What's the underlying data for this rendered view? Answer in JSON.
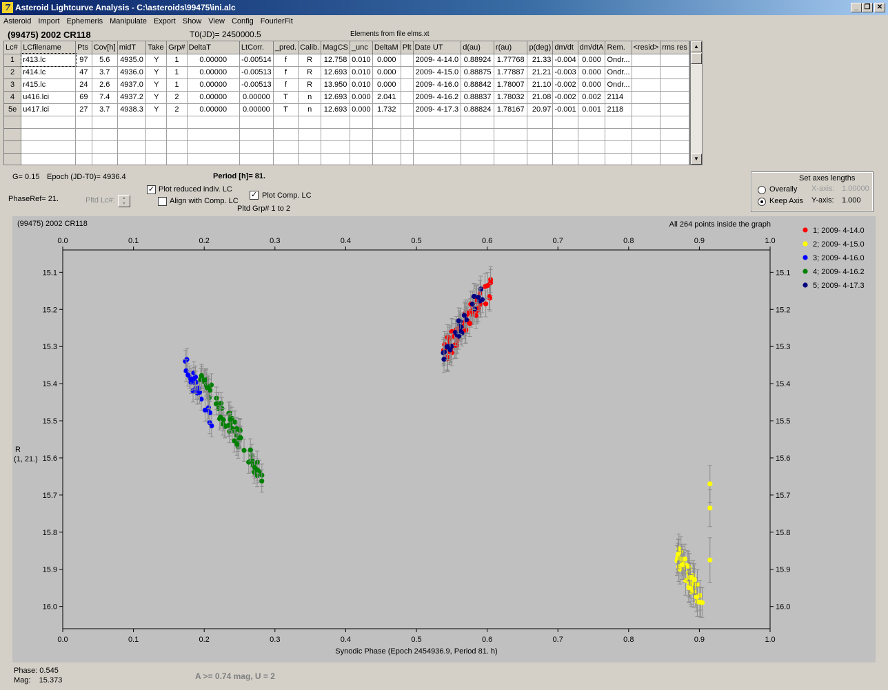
{
  "window": {
    "title": "Asteroid Lightcurve Analysis - C:\\asteroids\\99475\\ini.alc",
    "minimize": "_",
    "restore": "❐",
    "close": "✕"
  },
  "menu": [
    "Asteroid",
    "Import",
    "Ephemeris",
    "Manipulate",
    "Export",
    "Show",
    "View",
    "Config",
    "FourierFit"
  ],
  "header": {
    "asteroid": "(99475) 2002 CR118",
    "t0": "T0(JD)= 2450000.5",
    "elements": "Elements from file elms.xt"
  },
  "grid": {
    "columns": [
      "Lc#",
      "LCfilename",
      "Pts",
      "Cov[h]",
      "midT",
      "Take",
      "Grp#",
      "DeltaT",
      "LtCorr.",
      "_pred.",
      "Calib.",
      "MagCS",
      "_unc",
      "DeltaM",
      "Plt",
      "Date UT",
      "d(au)",
      "r(au)",
      "p(deg)",
      "dm/dt",
      "dm/dtA",
      "Rem.",
      "<resid>",
      "rms res"
    ],
    "rows": [
      [
        "1",
        "r413.lc",
        "97",
        "5.6",
        "4935.0",
        "Y",
        "1",
        "0.00000",
        "-0.00514",
        "f",
        "R",
        "12.758",
        "0.010",
        "0.000",
        "",
        "2009- 4-14.0",
        "0.88924",
        "1.77768",
        "21.33",
        "-0.004",
        "0.000",
        "Ondr...",
        "",
        ""
      ],
      [
        "2",
        "r414.lc",
        "47",
        "3.7",
        "4936.0",
        "Y",
        "1",
        "0.00000",
        "-0.00513",
        "f",
        "R",
        "12.693",
        "0.010",
        "0.000",
        "",
        "2009- 4-15.0",
        "0.88875",
        "1.77887",
        "21.21",
        "-0.003",
        "0.000",
        "Ondr...",
        "",
        ""
      ],
      [
        "3",
        "r415.lc",
        "24",
        "2.6",
        "4937.0",
        "Y",
        "1",
        "0.00000",
        "-0.00513",
        "f",
        "R",
        "13.950",
        "0.010",
        "0.000",
        "",
        "2009- 4-16.0",
        "0.88842",
        "1.78007",
        "21.10",
        "-0.002",
        "0.000",
        "Ondr...",
        "",
        ""
      ],
      [
        "4",
        "u416.lci",
        "69",
        "7.4",
        "4937.2",
        "Y",
        "2",
        "0.00000",
        "0.00000",
        "T",
        "n",
        "12.693",
        "0.000",
        "2.041",
        "",
        "2009- 4-16.2",
        "0.88837",
        "1.78032",
        "21.08",
        "-0.002",
        "0.002",
        "2114",
        "",
        ""
      ],
      [
        "5e",
        "u417.lci",
        "27",
        "3.7",
        "4938.3",
        "Y",
        "2",
        "0.00000",
        "0.00000",
        "T",
        "n",
        "12.693",
        "0.000",
        "1.732",
        "",
        "2009- 4-17.3",
        "0.88824",
        "1.78167",
        "20.97",
        "-0.001",
        "0.001",
        "2118",
        "",
        ""
      ]
    ],
    "empty_rows": 4
  },
  "params": {
    "g": "G= 0.15",
    "epoch": "Epoch (JD-T0)= 4936.4",
    "period": "Period [h]= 81.",
    "phase_ref": "PhaseRef= 21.",
    "pltd_lc": "Pltd Lc#:",
    "plot_reduced": "Plot reduced indiv. LC",
    "align_comp": "Align with Comp. LC",
    "plot_comp": "Plot Comp. LC",
    "pltd_grp": "Pltd Grp#  1   to   2",
    "check_mark": "✓"
  },
  "axes_settings": {
    "title": "Set axes lengths",
    "overally": "Overally",
    "keep_axis": "Keep Axis",
    "x_axis_label": "X-axis:",
    "x_axis_value": "1.00000",
    "y_axis_label": "Y-axis:",
    "y_axis_value": "1.000"
  },
  "status": {
    "phase": "Phase:  0.545",
    "mag": "Mag:    15.373",
    "amplitude": "A >= 0.74 mag, U = 2"
  },
  "chart_data": {
    "type": "scatter",
    "title": "(99475) 2002 CR118",
    "note": "All 264 points inside the graph",
    "xlabel": "Synodic Phase (Epoch 2454936.9, Period 81. h)",
    "ylabel": [
      "R",
      "(1, 21.)"
    ],
    "xlim": [
      0.0,
      1.0
    ],
    "ylim": [
      16.06,
      15.04
    ],
    "y_inverted": true,
    "x_ticks": [
      "0.0",
      "0.1",
      "0.2",
      "0.3",
      "0.4",
      "0.5",
      "0.6",
      "0.7",
      "0.8",
      "0.9",
      "1.0"
    ],
    "y_ticks": [
      "15.1",
      "15.2",
      "15.3",
      "15.4",
      "15.5",
      "15.6",
      "15.7",
      "15.8",
      "15.9",
      "16.0"
    ],
    "legend_position": "right",
    "series": [
      {
        "name": "1; 2009- 4-14.0",
        "color": "#ff0000",
        "clusters": [
          {
            "x0": 0.538,
            "x1": 0.608,
            "y0": 15.32,
            "y1": 15.13,
            "n": 60,
            "err": 0.035
          }
        ]
      },
      {
        "name": "2; 2009- 4-15.0",
        "color": "#ffff00",
        "clusters": [
          {
            "x0": 0.868,
            "x1": 0.905,
            "y0": 15.86,
            "y1": 15.99,
            "n": 42,
            "err": 0.04
          }
        ],
        "extra": [
          {
            "x": 0.915,
            "y": 15.67,
            "err": 0.05
          },
          {
            "x": 0.915,
            "y": 15.735,
            "err": 0.05
          },
          {
            "x": 0.915,
            "y": 15.875,
            "err": 0.06
          }
        ]
      },
      {
        "name": "3; 2009- 4-16.0",
        "color": "#0000ff",
        "clusters": [
          {
            "x0": 0.172,
            "x1": 0.212,
            "y0": 15.34,
            "y1": 15.52,
            "n": 24,
            "err": 0.03
          }
        ]
      },
      {
        "name": "4; 2009- 4-16.2",
        "color": "#008000",
        "clusters": [
          {
            "x0": 0.195,
            "x1": 0.285,
            "y0": 15.39,
            "y1": 15.65,
            "n": 69,
            "err": 0.03
          }
        ]
      },
      {
        "name": "5; 2009- 4-17.3",
        "color": "#000080",
        "clusters": [
          {
            "x0": 0.538,
            "x1": 0.595,
            "y0": 15.32,
            "y1": 15.15,
            "n": 27,
            "err": 0.035
          }
        ]
      }
    ]
  }
}
